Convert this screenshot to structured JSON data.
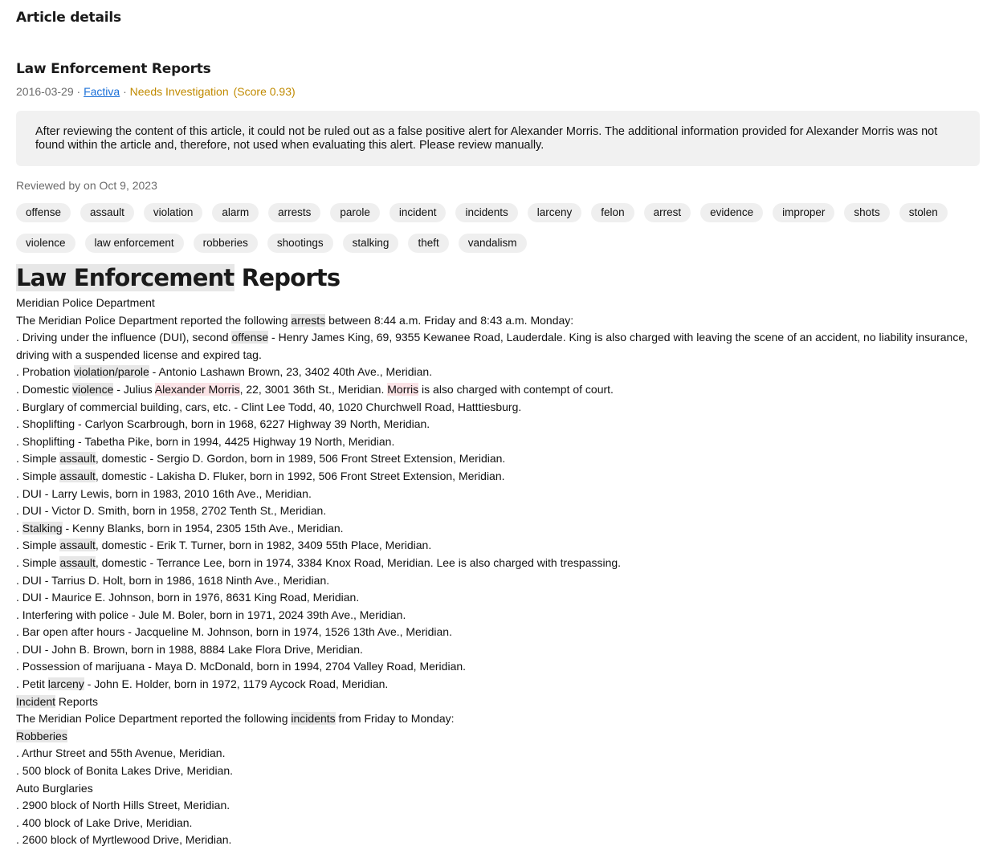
{
  "header": {
    "title": "Article details"
  },
  "article": {
    "title": "Law Enforcement Reports",
    "date": "2016-03-29",
    "sep1": " · ",
    "source": "Factiva",
    "sep2": " · ",
    "status": "Needs Investigation",
    "score": "(Score 0.93)"
  },
  "summary": "After reviewing the content of this article, it could not be ruled out as a false positive alert for Alexander Morris. The additional information provided for Alexander Morris was not found within the article and, therefore, not used when evaluating this alert. Please review manually.",
  "reviewed": "Reviewed by on Oct 9, 2023",
  "tags": [
    "offense",
    "assault",
    "violation",
    "alarm",
    "arrests",
    "parole",
    "incident",
    "incidents",
    "larceny",
    "felon",
    "arrest",
    "evidence",
    "improper",
    "shots",
    "stolen",
    "violence",
    "law enforcement",
    "robberies",
    "shootings",
    "stalking",
    "theft",
    "vandalism"
  ],
  "body": {
    "heading_hl": "Law Enforcement",
    "heading_rest": " Reports",
    "lines": [
      [
        {
          "t": "Meridian Police Department"
        }
      ],
      [
        {
          "t": "The Meridian Police Department reported the following "
        },
        {
          "t": "arrests",
          "h": 1
        },
        {
          "t": " between 8:44 a.m. Friday and 8:43 a.m. Monday:"
        }
      ],
      [
        {
          "t": ". Driving under the influence (DUI), second "
        },
        {
          "t": "offense",
          "h": 1
        },
        {
          "t": " - Henry James King, 69, 9355 Kewanee Road, Lauderdale. King is also charged with leaving the scene of an accident, no liability insurance, driving with a suspended license and expired tag."
        }
      ],
      [
        {
          "t": ". Probation "
        },
        {
          "t": "violation/parole",
          "h": 1
        },
        {
          "t": " - Antonio Lashawn Brown, 23, 3402 40th Ave., Meridian."
        }
      ],
      [
        {
          "t": ". Domestic "
        },
        {
          "t": "violence",
          "h": 1
        },
        {
          "t": " - Julius "
        },
        {
          "t": "Alexander Morris",
          "h": 2
        },
        {
          "t": ", 22, 3001 36th St., Meridian. "
        },
        {
          "t": "Morris",
          "h": 2
        },
        {
          "t": " is also charged with contempt of court."
        }
      ],
      [
        {
          "t": ". Burglary of commercial building, cars, etc. - Clint Lee Todd, 40, 1020 Churchwell Road, Hatttiesburg."
        }
      ],
      [
        {
          "t": ". Shoplifting - Carlyon Scarbrough, born in 1968, 6227 Highway 39 North, Meridian."
        }
      ],
      [
        {
          "t": ". Shoplifting - Tabetha Pike, born in 1994, 4425 Highway 19 North, Meridian."
        }
      ],
      [
        {
          "t": ". Simple "
        },
        {
          "t": "assault",
          "h": 1
        },
        {
          "t": ", domestic - Sergio D. Gordon, born in 1989, 506 Front Street Extension, Meridian."
        }
      ],
      [
        {
          "t": ". Simple "
        },
        {
          "t": "assault",
          "h": 1
        },
        {
          "t": ", domestic - Lakisha D. Fluker, born in 1992, 506 Front Street Extension, Meridian."
        }
      ],
      [
        {
          "t": ". DUI - Larry Lewis, born in 1983, 2010 16th Ave., Meridian."
        }
      ],
      [
        {
          "t": ". DUI - Victor D. Smith, born in 1958, 2702 Tenth St., Meridian."
        }
      ],
      [
        {
          "t": ". "
        },
        {
          "t": "Stalking",
          "h": 1
        },
        {
          "t": " - Kenny Blanks, born in 1954, 2305 15th Ave., Meridian."
        }
      ],
      [
        {
          "t": ". Simple "
        },
        {
          "t": "assault",
          "h": 1
        },
        {
          "t": ", domestic - Erik T. Turner, born in 1982, 3409 55th Place, Meridian."
        }
      ],
      [
        {
          "t": ". Simple "
        },
        {
          "t": "assault",
          "h": 1
        },
        {
          "t": ", domestic - Terrance Lee, born in 1974, 3384 Knox Road, Meridian. Lee is also charged with trespassing."
        }
      ],
      [
        {
          "t": ". DUI - Tarrius D. Holt, born in 1986, 1618 Ninth Ave., Meridian."
        }
      ],
      [
        {
          "t": ". DUI - Maurice E. Johnson, born in 1976, 8631 King Road, Meridian."
        }
      ],
      [
        {
          "t": ". Interfering with police - Jule M. Boler, born in 1971, 2024 39th Ave., Meridian."
        }
      ],
      [
        {
          "t": ". Bar open after hours - Jacqueline M. Johnson, born in 1974, 1526 13th Ave., Meridian."
        }
      ],
      [
        {
          "t": ". DUI - John B. Brown, born in 1988, 8884 Lake Flora Drive, Meridian."
        }
      ],
      [
        {
          "t": ". Possession of marijuana - Maya D. McDonald, born in 1994, 2704 Valley Road, Meridian."
        }
      ],
      [
        {
          "t": ". Petit "
        },
        {
          "t": "larceny",
          "h": 1
        },
        {
          "t": " - John E. Holder, born in 1972, 1179 Aycock Road, Meridian."
        }
      ],
      [
        {
          "t": "Incident",
          "h": 1
        },
        {
          "t": " Reports"
        }
      ],
      [
        {
          "t": "The Meridian Police Department reported the following "
        },
        {
          "t": "incidents",
          "h": 1
        },
        {
          "t": " from Friday to Monday:"
        }
      ],
      [
        {
          "t": "Robberies",
          "h": 1
        }
      ],
      [
        {
          "t": ". Arthur Street and 55th Avenue, Meridian."
        }
      ],
      [
        {
          "t": ". 500 block of Bonita Lakes Drive, Meridian."
        }
      ],
      [
        {
          "t": "Auto Burglaries"
        }
      ],
      [
        {
          "t": ". 2900 block of North Hills Street, Meridian."
        }
      ],
      [
        {
          "t": ". 400 block of Lake Drive, Meridian."
        }
      ],
      [
        {
          "t": ". 2600 block of Myrtlewood Drive, Meridian."
        }
      ]
    ]
  }
}
